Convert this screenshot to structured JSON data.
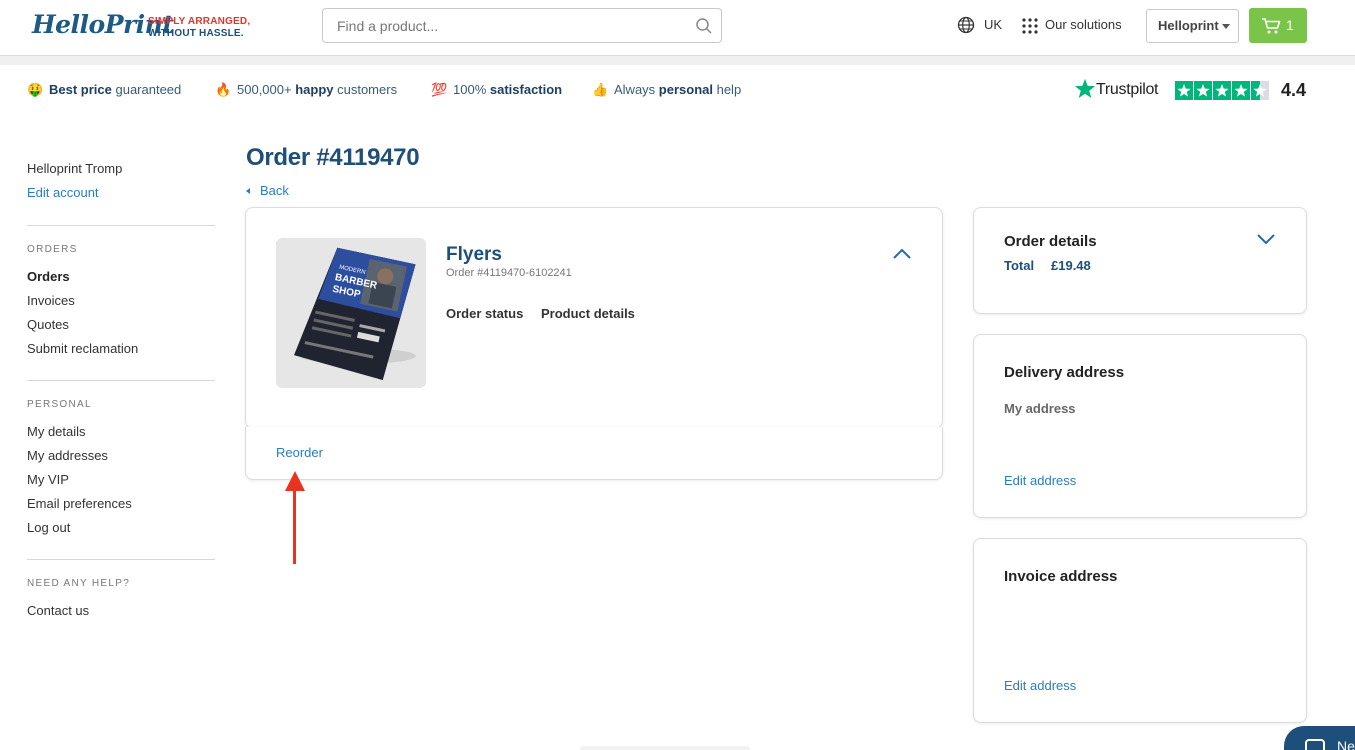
{
  "header": {
    "logo": "HelloPrint",
    "tagline_1": "SIMPLY ARRANGED,",
    "tagline_2": "WITHOUT HASSLE.",
    "search_placeholder": "Find a product...",
    "country": "UK",
    "solutions": "Our solutions",
    "account_select": "Helloprint",
    "cart_count": "1"
  },
  "usps": [
    {
      "icon": "drooling-face-emoji",
      "glyph": "🤑",
      "bold": "Best price",
      "rest": " guaranteed"
    },
    {
      "icon": "fire-emoji",
      "glyph": "🔥",
      "pre": "500,000+ ",
      "bold": "happy",
      "rest": " customers"
    },
    {
      "icon": "hundred-points-emoji",
      "glyph": "💯",
      "pre": "100% ",
      "bold": "satisfaction",
      "rest": ""
    },
    {
      "icon": "thumbs-up-emoji",
      "glyph": "👍",
      "pre": "Always ",
      "bold": "personal",
      "rest": " help"
    }
  ],
  "trustpilot": {
    "label": "Trustpilot",
    "score": "4.4",
    "stars": 4.5
  },
  "sidebar": {
    "user_name": "Helloprint Tromp",
    "edit_account": "Edit account",
    "orders_heading": "ORDERS",
    "orders_items": [
      "Orders",
      "Invoices",
      "Quotes",
      "Submit reclamation"
    ],
    "personal_heading": "PERSONAL",
    "personal_items": [
      "My details",
      "My addresses",
      "My VIP",
      "Email preferences",
      "Log out"
    ],
    "help_heading": "NEED ANY HELP?",
    "help_items": [
      "Contact us"
    ]
  },
  "order": {
    "title": "Order #4119470",
    "back": "Back",
    "product_name": "Flyers",
    "product_order_number": "Order #4119470-6102241",
    "tab_status": "Order status",
    "tab_details": "Product details",
    "reorder": "Reorder",
    "thumb_text": {
      "line1": "MODERN",
      "line2": "BARBER",
      "line3": "SHOP"
    }
  },
  "order_details": {
    "title": "Order details",
    "total_label": "Total",
    "total_value": "£19.48"
  },
  "delivery": {
    "title": "Delivery address",
    "address_name": "My address",
    "edit": "Edit address"
  },
  "invoice": {
    "title": "Invoice address",
    "edit": "Edit address"
  },
  "chat": {
    "label": "Ne"
  },
  "colors": {
    "brand": "#1d4f7a",
    "link": "#2a7cc0",
    "cart_green": "#7bc44a",
    "trustpilot_green": "#00b67a",
    "annotation_red": "#e8331f"
  }
}
